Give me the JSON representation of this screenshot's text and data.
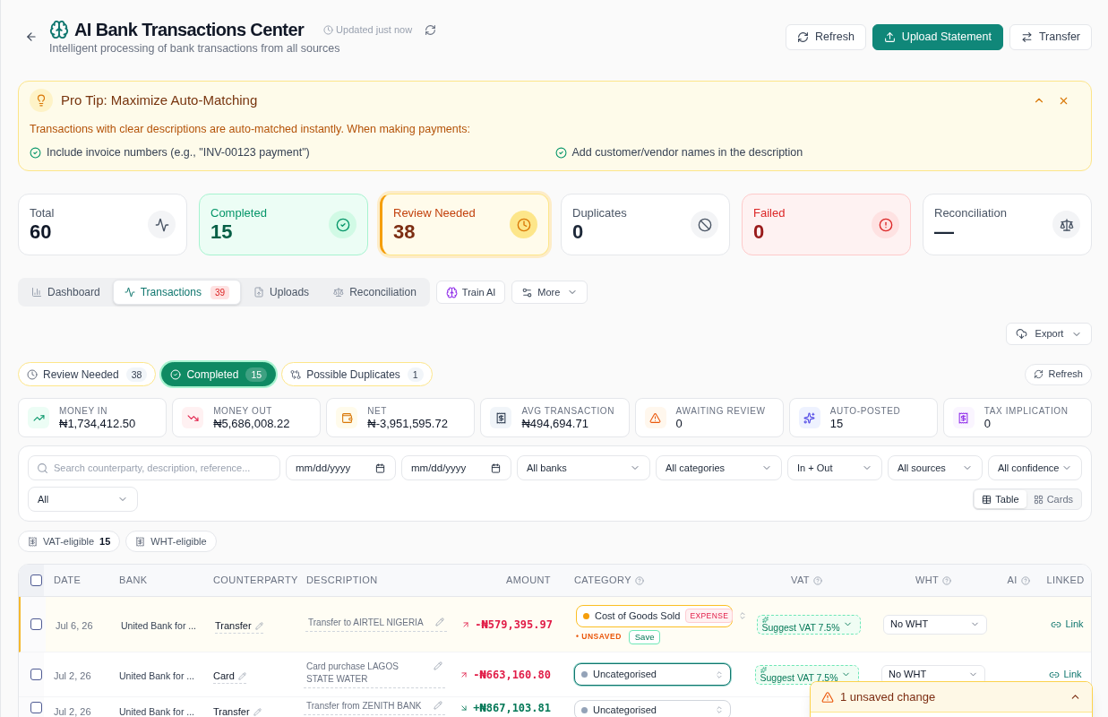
{
  "header": {
    "title": "AI Bank Transactions Center",
    "subtitle": "Intelligent processing of bank transactions from all sources",
    "updated": "Updated just now",
    "actions": [
      {
        "kind": "refresh",
        "label": "Refresh"
      },
      {
        "kind": "upload",
        "label": "Upload Statement"
      },
      {
        "kind": "transfer",
        "label": "Transfer"
      }
    ]
  },
  "pro_tip": {
    "title": "Pro Tip: Maximize Auto-Matching",
    "expanded": true,
    "text": "Transactions with clear descriptions are auto-matched instantly. When making payments:",
    "tips": [
      "Include invoice numbers (e.g., \"INV-00123 payment\")",
      "Add customer/vendor names in the description"
    ]
  },
  "status_cards": [
    {
      "kind": "total",
      "label": "Total",
      "value": "60",
      "selected": false
    },
    {
      "kind": "completed",
      "label": "Completed",
      "value": "15",
      "selected": false
    },
    {
      "kind": "review",
      "label": "Review Needed",
      "value": "38",
      "selected": true
    },
    {
      "kind": "duplicates",
      "label": "Duplicates",
      "value": "0",
      "selected": false
    },
    {
      "kind": "failed",
      "label": "Failed",
      "value": "0",
      "selected": false
    },
    {
      "kind": "reconciliation",
      "label": "Reconciliation",
      "value": "—",
      "selected": false
    }
  ],
  "nav_tabs": [
    {
      "kind": "dashboard",
      "label": "Dashboard",
      "selected": false
    },
    {
      "kind": "transactions",
      "label": "Transactions",
      "badge": "39",
      "selected": true
    },
    {
      "kind": "uploads",
      "label": "Uploads",
      "selected": false
    },
    {
      "kind": "reconciliation",
      "label": "Reconciliation",
      "selected": false
    }
  ],
  "tools": [
    {
      "kind": "train",
      "label": "Train AI"
    },
    {
      "kind": "more",
      "label": "More"
    }
  ],
  "export": {
    "label": "Export"
  },
  "status_filters": [
    {
      "kind": "review",
      "label": "Review Needed",
      "count": "38",
      "selected": false
    },
    {
      "kind": "completed",
      "label": "Completed",
      "count": "15",
      "selected": true
    },
    {
      "kind": "duplicates",
      "label": "Possible Duplicates",
      "count": "1",
      "selected": false
    }
  ],
  "refresh": {
    "label": "Refresh"
  },
  "summary": [
    {
      "kind": "in",
      "label": "MONEY IN",
      "value": "₦1,734,412.50"
    },
    {
      "kind": "out",
      "label": "MONEY OUT",
      "value": "₦5,686,008.22"
    },
    {
      "kind": "net",
      "label": "NET",
      "value": "₦-3,951,595.72"
    },
    {
      "kind": "avg",
      "label": "AVG TRANSACTION",
      "value": "₦494,694.71"
    },
    {
      "kind": "review",
      "label": "AWAITING REVIEW",
      "value": "0"
    },
    {
      "kind": "auto",
      "label": "AUTO-POSTED",
      "value": "15"
    },
    {
      "kind": "tax",
      "label": "TAX IMPLICATION",
      "value": "0"
    }
  ],
  "filters": {
    "search": {
      "placeholder": "Search counterparty, description, reference..."
    },
    "dates": [
      {
        "placeholder": "mm/dd/yyyy"
      },
      {
        "placeholder": "mm/dd/yyyy"
      }
    ],
    "selects": [
      "All banks",
      "All categories",
      "In + Out",
      "All sources",
      "All confidence"
    ],
    "type_select": "All",
    "views": [
      {
        "kind": "table",
        "label": "Table",
        "selected": true
      },
      {
        "kind": "cards",
        "label": "Cards",
        "selected": false
      }
    ]
  },
  "tax_chips": [
    {
      "label": "VAT-eligible",
      "count": "15"
    },
    {
      "label": "WHT-eligible"
    }
  ],
  "table": {
    "select_all": {
      "checked": false
    },
    "columns": [
      {
        "label": "DATE"
      },
      {
        "label": "BANK"
      },
      {
        "label": "COUNTERPARTY"
      },
      {
        "label": "DESCRIPTION"
      },
      {
        "label": "AMOUNT"
      },
      {
        "label": "CATEGORY",
        "help": true
      },
      {
        "label": "VAT",
        "help": true
      },
      {
        "label": "WHT",
        "help": true
      },
      {
        "label": "AI",
        "help": true
      },
      {
        "label": "LINKED"
      }
    ],
    "rows": [
      {
        "kind": "debit",
        "checked": false,
        "unsaved": true,
        "date": "Jul 6, 26",
        "bank": "United Bank for ...",
        "counterparty": "Transfer",
        "description": "Transfer to AIRTEL NIGERIA",
        "amount": "-₦579,395.97",
        "category": {
          "label": "Cost of Goods Sold",
          "color": "#f59e0b",
          "badge": "EXPENSE",
          "focused": false,
          "unsaved_label": "• UNSAVED",
          "save": "Save"
        },
        "vat": "Suggest VAT 7.5%",
        "wht": "No WHT",
        "link": "Link"
      },
      {
        "kind": "debit",
        "checked": false,
        "unsaved": false,
        "date": "Jul 2, 26",
        "bank": "United Bank for ...",
        "counterparty": "Card",
        "description": "Card purchase LAGOS STATE WATER",
        "amount": "-₦663,160.80",
        "category": {
          "label": "Uncategorised",
          "color": "#94a3b8",
          "focused": true
        },
        "vat": "Suggest VAT 7.5%",
        "wht": "No WHT",
        "link": "Link"
      },
      {
        "kind": "credit",
        "checked": false,
        "unsaved": false,
        "date": "Jul 2, 26",
        "bank": "United Bank for ...",
        "counterparty": "Transfer",
        "description": "Transfer from ZENITH BANK",
        "amount": "+₦867,103.81",
        "category": {
          "label": "Uncategorised",
          "color": "#94a3b8",
          "focused": false
        }
      }
    ]
  },
  "unsaved_bar": {
    "text": "1 unsaved change"
  }
}
